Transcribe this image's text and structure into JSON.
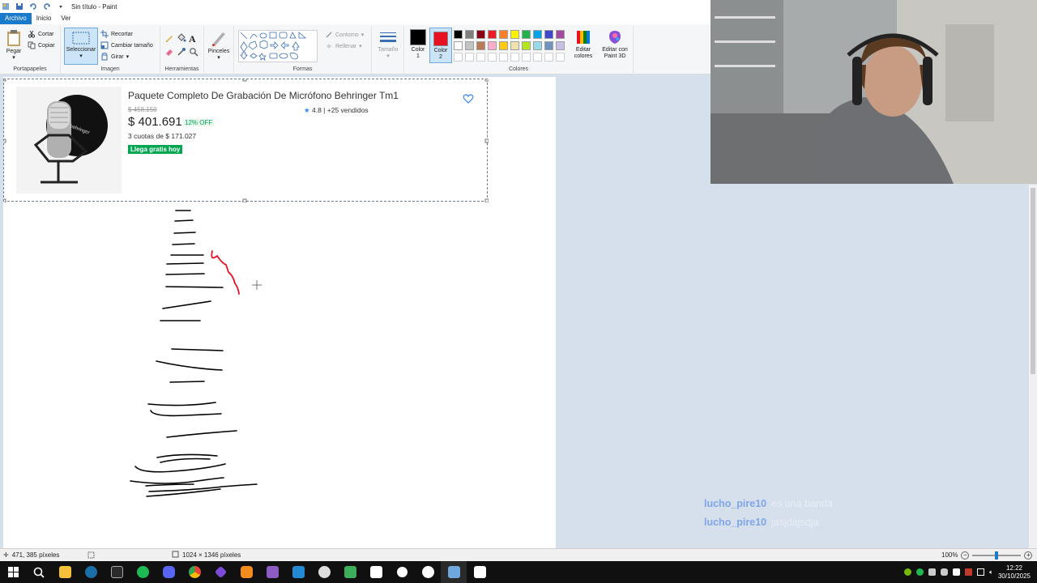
{
  "window": {
    "title": "Sin título - Paint"
  },
  "tabs": [
    {
      "label": "Archivo"
    },
    {
      "label": "Inicio"
    },
    {
      "label": "Ver"
    }
  ],
  "ribbon": {
    "clipboard": {
      "paste_label": "Pegar",
      "cut_label": "Cortar",
      "copy_label": "Copiar",
      "group_label": "Portapapeles"
    },
    "image": {
      "select_label": "Seleccionar",
      "crop_label": "Recortar",
      "resize_label": "Cambiar tamaño",
      "rotate_label": "Girar",
      "group_label": "Imagen"
    },
    "tools": {
      "group_label": "Herramientas"
    },
    "brushes": {
      "label": "Pinceles"
    },
    "shapes": {
      "outline_label": "Contorno",
      "fill_label": "Rellenar",
      "group_label": "Formas"
    },
    "size": {
      "label": "Tamaño"
    },
    "colors": {
      "color1_label": "Color 1",
      "color2_label": "Color 2",
      "color1": "#000000",
      "color2": "#e81123",
      "edit_colors_label": "Editar colores",
      "paint3d_label": "Editar con Paint 3D",
      "group_label": "Colores",
      "palette": [
        "#000000",
        "#7f7f7f",
        "#880015",
        "#ed1c24",
        "#ff7f27",
        "#fff200",
        "#22b14c",
        "#00a2e8",
        "#3f48cc",
        "#a349a4",
        "#ffffff",
        "#c3c3c3",
        "#b97a57",
        "#ffaec9",
        "#ffc90e",
        "#efe4b0",
        "#b5e61d",
        "#99d9ea",
        "#7092be",
        "#c8bfe7",
        "#ffffff",
        "#ffffff",
        "#ffffff",
        "#ffffff",
        "#ffffff",
        "#ffffff",
        "#ffffff",
        "#ffffff",
        "#ffffff",
        "#ffffff"
      ]
    }
  },
  "canvas_content": {
    "product_title": "Paquete Completo De Grabación De Micrófono Behringer Tm1",
    "old_price": "$ 458.150",
    "price": "$ 401.691",
    "discount": "12% OFF",
    "installments": "3 cuotas de $ 171.027",
    "shipping": "Llega gratis hoy",
    "rating": "4.8 | +25 vendidos",
    "brand_on_mic": "behringer"
  },
  "statusbar": {
    "cursor_position": "471, 385 píxeles",
    "image_size": "1024 × 1346 píxeles",
    "zoom": "100%"
  },
  "chat": [
    {
      "user": "lucho_pire10",
      "message": "es una banda"
    },
    {
      "user": "lucho_pire10",
      "message": "jasjdajsdja"
    }
  ],
  "taskbar": {
    "time": "12:22",
    "date": "30/10/2025"
  }
}
